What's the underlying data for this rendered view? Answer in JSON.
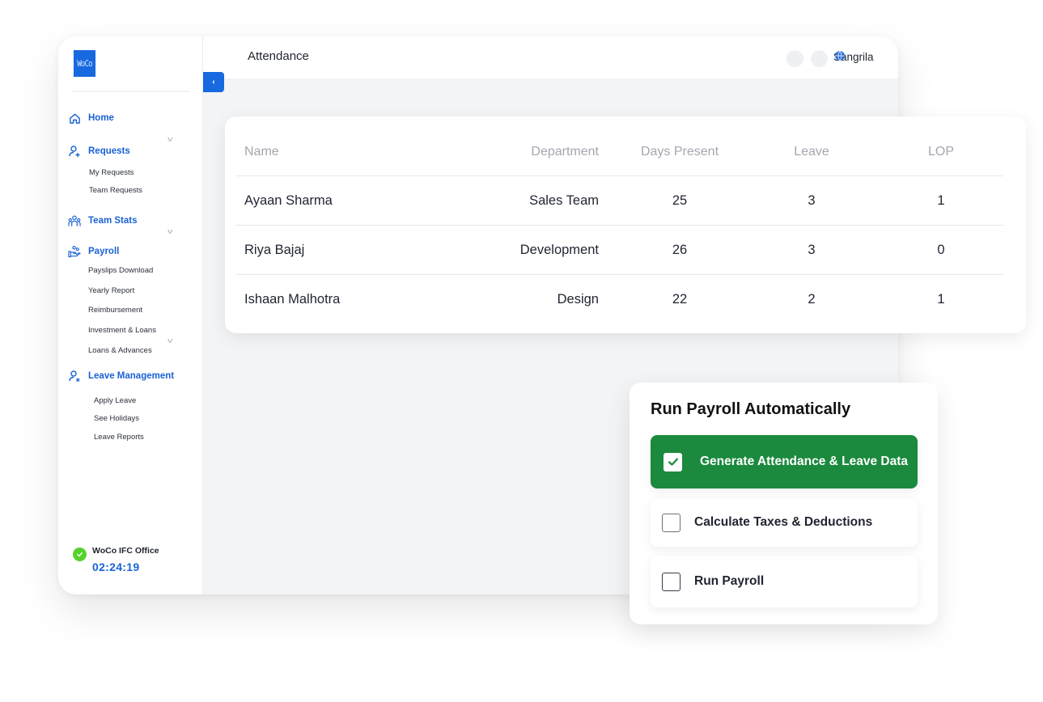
{
  "app": {
    "logo_text": "WoCo",
    "page_title": "Attendance",
    "user_name": "Sangrila"
  },
  "sidebar": {
    "sections": [
      {
        "label": "Home",
        "icon": "home-icon",
        "children": []
      },
      {
        "label": "Requests",
        "icon": "user-plus-icon",
        "children": [
          "My Requests",
          "Team Requests"
        ]
      },
      {
        "label": "Team Stats",
        "icon": "team-icon",
        "children": []
      },
      {
        "label": "Payroll",
        "icon": "hand-coins-icon",
        "children": [
          "Payslips Download",
          "Yearly Report",
          "Reimbursement",
          "Investment & Loans",
          "Loans & Advances"
        ]
      },
      {
        "label": "Leave Management",
        "icon": "user-x-icon",
        "children": [
          "Apply Leave",
          "See Holidays",
          "Leave Reports"
        ]
      }
    ],
    "office": {
      "name": "WoCo IFC Office",
      "time": "02:24:19",
      "status": "checked-in"
    }
  },
  "attendance_table": {
    "columns": [
      "Name",
      "Department",
      "Days Present",
      "Leave",
      "LOP"
    ],
    "rows": [
      [
        "Ayaan Sharma",
        "Sales Team",
        "25",
        "3",
        "1"
      ],
      [
        "Riya Bajaj",
        "Development",
        "26",
        "3",
        "0"
      ],
      [
        "Ishaan Malhotra",
        "Design",
        "22",
        "2",
        "1"
      ]
    ]
  },
  "payroll_card": {
    "title": "Run Payroll Automatically",
    "steps": [
      {
        "label": "Generate Attendance & Leave Data",
        "checked": true
      },
      {
        "label": "Calculate Taxes & Deductions",
        "checked": false
      },
      {
        "label": "Run Payroll",
        "checked": false
      }
    ]
  },
  "colors": {
    "brand_blue": "#1769e0",
    "nav_blue": "#1a62d6",
    "success_green": "#1b8a3e",
    "status_green": "#56d22b",
    "header_gray": "#a3a7ae"
  }
}
